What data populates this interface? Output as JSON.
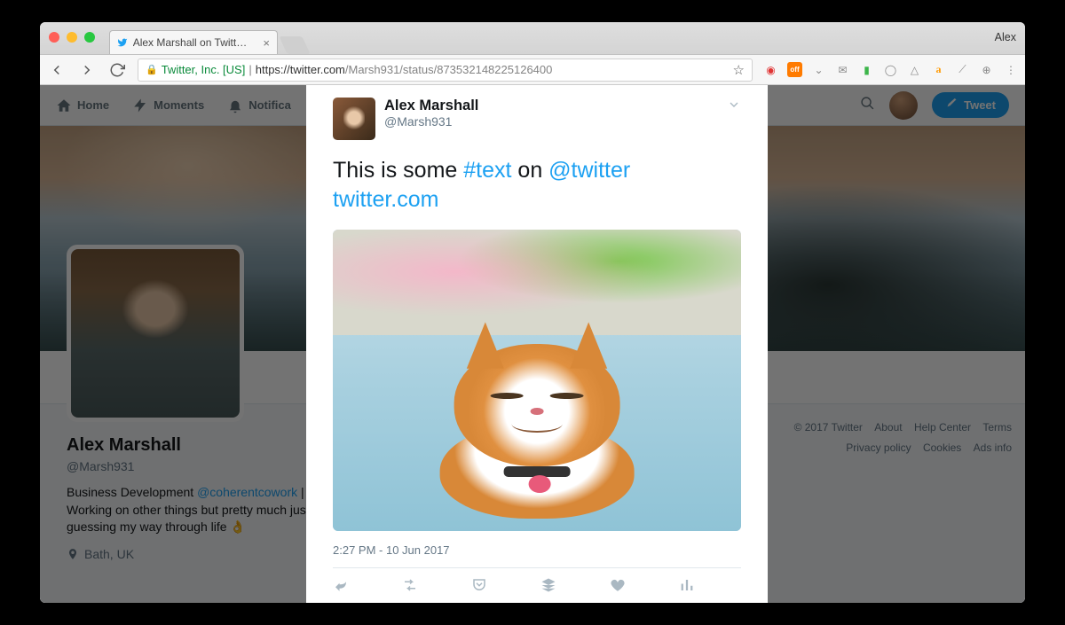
{
  "browser": {
    "profile_name": "Alex",
    "tab_title": "Alex Marshall on Twitter: \"This",
    "url_org": "Twitter, Inc. [US]",
    "url_scheme_host": "https://twitter.com",
    "url_path": "/Marsh931/status/873532148225126400"
  },
  "topnav": {
    "home": "Home",
    "moments": "Moments",
    "notifications": "Notifica",
    "tweet_button": "Tweet"
  },
  "profile": {
    "name": "Alex Marshall",
    "handle": "@Marsh931",
    "bio_pre": "Business Development ",
    "bio_mention": "@coherentcowork",
    "bio_post": " | Working on other things but pretty much just guessing my way through life 👌",
    "location": "Bath, UK"
  },
  "footer": {
    "copyright": "© 2017 Twitter",
    "about": "About",
    "help": "Help Center",
    "terms": "Terms",
    "privacy": "Privacy policy",
    "cookies": "Cookies",
    "ads": "Ads info"
  },
  "tweet": {
    "author_name": "Alex Marshall",
    "author_handle": "@Marsh931",
    "text_pre": "This is some ",
    "hashtag": "#text",
    "mid": " on ",
    "mention": "@twitter",
    "space": "  ",
    "url": "twitter.com",
    "timestamp": "2:27 PM - 10 Jun 2017"
  }
}
